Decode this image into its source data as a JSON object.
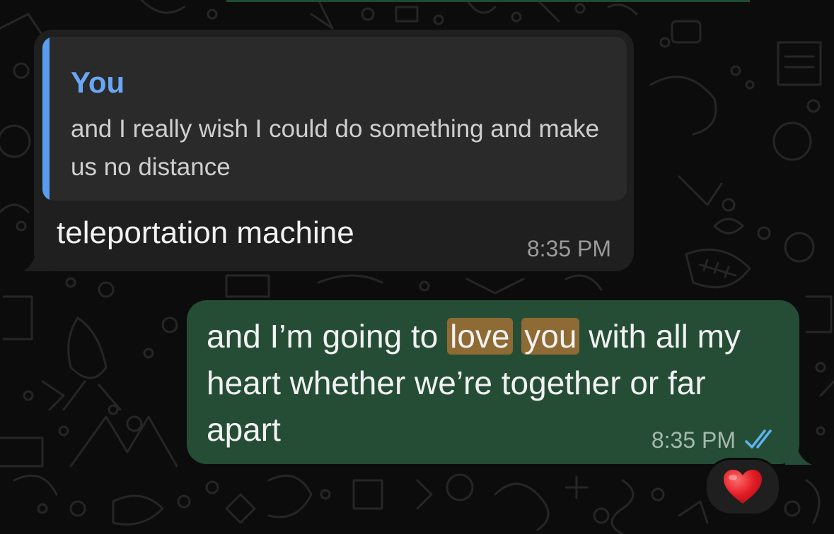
{
  "incoming": {
    "quote": {
      "author": "You",
      "text": "and I really wish I could do something and make us no distance"
    },
    "text": "teleportation machine",
    "time": "8:35 PM"
  },
  "outgoing": {
    "text_before": "and I’m going to ",
    "highlight_1": "love",
    "text_between": " ",
    "highlight_2": "you",
    "text_after": " with all my heart whether we’re together or far apart",
    "time": "8:35 PM",
    "status_icon": "double-check-read-icon"
  },
  "reaction": {
    "emoji_icon": "red-heart-icon"
  },
  "colors": {
    "incoming_bubble": "#1f1f1f",
    "outgoing_bubble": "#254d36",
    "quote_accent": "#5a9cf0",
    "highlight": "#8e6a34",
    "read_ticks": "#5ab4f0"
  }
}
